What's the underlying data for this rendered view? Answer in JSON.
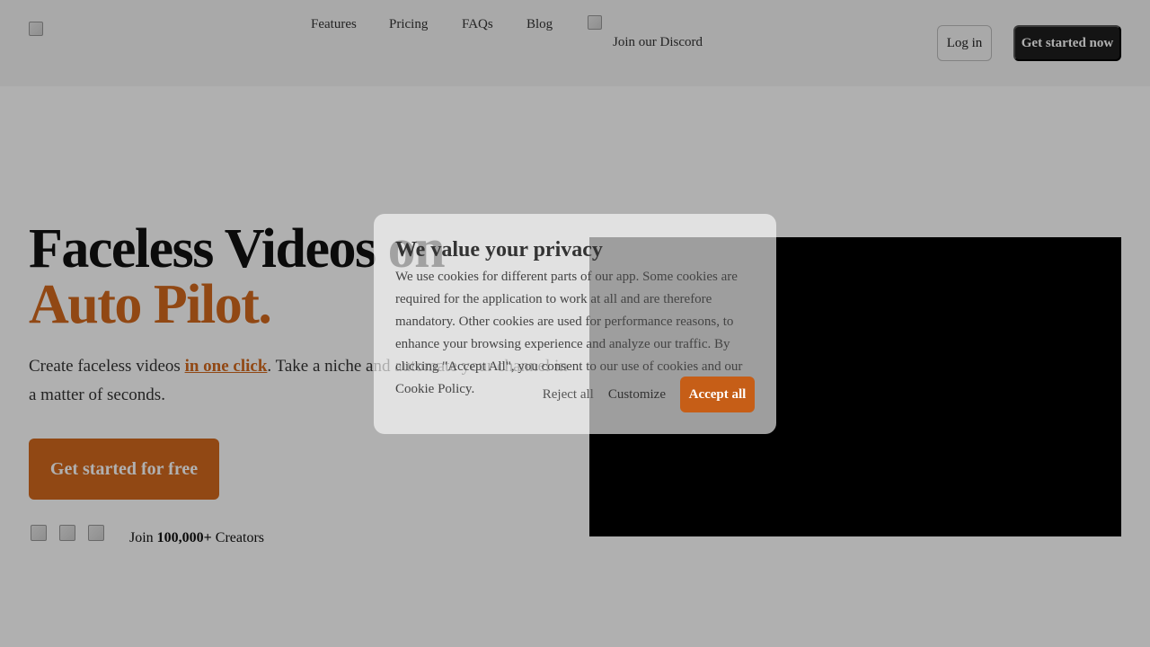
{
  "header": {
    "nav": [
      "Features",
      "Pricing",
      "FAQs",
      "Blog"
    ],
    "discord_label": "Join our Discord",
    "login_label": "Log in",
    "get_started_label": "Get started now"
  },
  "hero": {
    "title_line1": "Faceless Videos on",
    "title_line2": "Auto Pilot.",
    "subtitle_before": "Create faceless videos ",
    "subtitle_link": "in one click",
    "subtitle_after": ". Take a niche and automate your channel in a matter of seconds.",
    "cta_label": "Get started for free",
    "creators_prefix": "Join ",
    "creators_count": "100,000+",
    "creators_suffix": " Creators"
  },
  "cookie_dialog": {
    "title": "We value your privacy",
    "body": "We use cookies for different parts of our app. Some cookies are required for the application to work at all and are therefore mandatory. Other cookies are used for performance reasons, to enhance your browsing experience and analyze our traffic. By clicking \"Accept All\", you consent to our use of cookies and our Cookie Policy.",
    "reject_label": "Reject all",
    "customize_label": "Customize",
    "accept_label": "Accept all"
  },
  "colors": {
    "accent": "#d2691e",
    "dark_button": "#1d1d1d",
    "video_bg": "#000000"
  }
}
